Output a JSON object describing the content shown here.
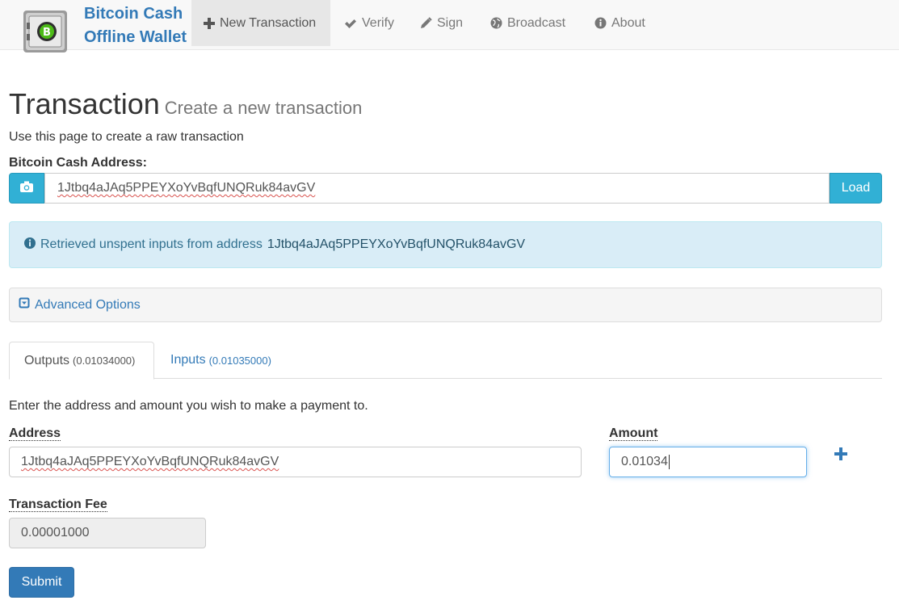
{
  "brand": {
    "line1": "Bitcoin Cash",
    "line2": "Offline Wallet",
    "logo_icon": "safe-icon"
  },
  "nav": {
    "items": [
      {
        "label": "New Transaction",
        "icon": "plus-icon",
        "active": true
      },
      {
        "label": "Verify",
        "icon": "check-icon",
        "active": false
      },
      {
        "label": "Sign",
        "icon": "pencil-icon",
        "active": false
      },
      {
        "label": "Broadcast",
        "icon": "globe-icon",
        "active": false
      },
      {
        "label": "About",
        "icon": "info-icon",
        "active": false
      }
    ]
  },
  "page": {
    "title": "Transaction",
    "subtitle": "Create a new transaction",
    "intro": "Use this page to create a raw transaction"
  },
  "address_section": {
    "label": "Bitcoin Cash Address",
    "label_suffix": ":",
    "value": "1Jtbq4aJAq5PPEYXoYvBqfUNQRuk84avGV",
    "load_label": "Load",
    "camera_icon": "camera-icon"
  },
  "alert": {
    "text": "Retrieved unspent inputs from address",
    "address": "1Jtbq4aJAq5PPEYXoYvBqfUNQRuk84avGV",
    "icon": "info-circle-icon"
  },
  "advanced": {
    "label": "Advanced Options",
    "icon": "caret-square-down-icon"
  },
  "tabs": [
    {
      "label": "Outputs",
      "amount": "(0.01034000)",
      "active": true
    },
    {
      "label": "Inputs",
      "amount": "(0.01035000)",
      "active": false
    }
  ],
  "outputs": {
    "intro": "Enter the address and amount you wish to make a payment to.",
    "address_label": "Address",
    "address_value": "1Jtbq4aJAq5PPEYXoYvBqfUNQRuk84avGV",
    "amount_label": "Amount",
    "amount_value": "0.01034",
    "add_icon": "plus-icon"
  },
  "fee": {
    "label": "Transaction Fee",
    "value": "0.00001000"
  },
  "submit_label": "Submit",
  "colors": {
    "brand": "#337ab7",
    "info_button": "#31b0d5",
    "alert_bg": "#d9edf7",
    "alert_text": "#31708f",
    "primary": "#337ab7"
  }
}
